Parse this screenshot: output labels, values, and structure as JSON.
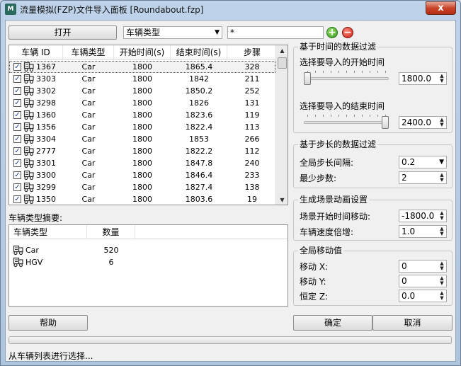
{
  "window": {
    "title": "流量模拟(FZP)文件导入面板 [Roundabout.fzp]",
    "icon_label": "M",
    "close_label": "x"
  },
  "toolbar": {
    "open_label": "打开",
    "filter_field": "车辆类型",
    "filter_value": "*",
    "add_icon": "plus-icon",
    "remove_icon": "minus-icon"
  },
  "vehicles": {
    "columns": [
      "车辆 ID",
      "车辆类型",
      "开始时间(s)",
      "结束时间(s)",
      "步骤"
    ],
    "rows": [
      {
        "id": "1367",
        "type": "Car",
        "start": "1800",
        "end": "1865.4",
        "steps": "328",
        "checked": true,
        "selected": true
      },
      {
        "id": "3303",
        "type": "Car",
        "start": "1800",
        "end": "1842",
        "steps": "211",
        "checked": true
      },
      {
        "id": "3302",
        "type": "Car",
        "start": "1800",
        "end": "1850.2",
        "steps": "252",
        "checked": true
      },
      {
        "id": "3298",
        "type": "Car",
        "start": "1800",
        "end": "1826",
        "steps": "131",
        "checked": true
      },
      {
        "id": "1360",
        "type": "Car",
        "start": "1800",
        "end": "1823.6",
        "steps": "119",
        "checked": true
      },
      {
        "id": "1356",
        "type": "Car",
        "start": "1800",
        "end": "1822.4",
        "steps": "113",
        "checked": true
      },
      {
        "id": "3304",
        "type": "Car",
        "start": "1800",
        "end": "1853",
        "steps": "266",
        "checked": true
      },
      {
        "id": "2777",
        "type": "Car",
        "start": "1800",
        "end": "1822.2",
        "steps": "112",
        "checked": true
      },
      {
        "id": "3301",
        "type": "Car",
        "start": "1800",
        "end": "1847.8",
        "steps": "240",
        "checked": true
      },
      {
        "id": "3300",
        "type": "Car",
        "start": "1800",
        "end": "1846.4",
        "steps": "233",
        "checked": true
      },
      {
        "id": "3299",
        "type": "Car",
        "start": "1800",
        "end": "1827.4",
        "steps": "138",
        "checked": true
      },
      {
        "id": "1350",
        "type": "Car",
        "start": "1800",
        "end": "1803.6",
        "steps": "19",
        "checked": true
      }
    ]
  },
  "summary": {
    "title": "车辆类型摘要:",
    "columns": [
      "车辆类型",
      "数量"
    ],
    "rows": [
      {
        "type": "Car",
        "count": "520"
      },
      {
        "type": "HGV",
        "count": "6"
      }
    ]
  },
  "time_filter": {
    "title": "基于时间的数据过滤",
    "start_label": "选择要导入的开始时间",
    "start_value": "1800.0",
    "end_label": "选择要导入的结束时间",
    "end_value": "2400.0",
    "start_slider_fraction": 0.0,
    "end_slider_fraction": 1.0
  },
  "step_filter": {
    "title": "基于步长的数据过滤",
    "interval_label": "全局步长间隔:",
    "interval_value": "0.2",
    "min_steps_label": "最少步数:",
    "min_steps_value": "2"
  },
  "animation": {
    "title": "生成场景动画设置",
    "offset_label": "场景开始时间移动:",
    "offset_value": "-1800.0",
    "speed_label": "车辆速度倍增:",
    "speed_value": "1.0"
  },
  "global_move": {
    "title": "全局移动值",
    "x_label": "移动 X:",
    "x_value": "0",
    "y_label": "移动 Y:",
    "y_value": "0",
    "z_label": "恒定 Z:",
    "z_value": "0.0"
  },
  "footer": {
    "help_label": "帮助",
    "ok_label": "确定",
    "cancel_label": "取消",
    "status": "从车辆列表进行选择..."
  }
}
